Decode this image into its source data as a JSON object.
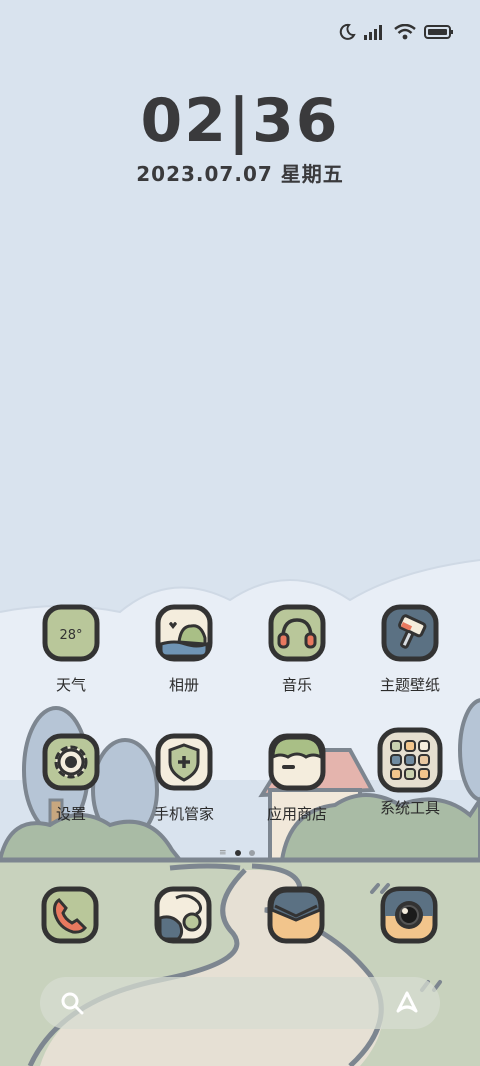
{
  "clock": {
    "time": "02|36",
    "date": "2023.07.07 星期五"
  },
  "weather_temp": "28°",
  "apps": [
    {
      "id": "weather",
      "label": "天气"
    },
    {
      "id": "gallery",
      "label": "相册"
    },
    {
      "id": "music",
      "label": "音乐"
    },
    {
      "id": "themes",
      "label": "主题壁纸"
    },
    {
      "id": "settings",
      "label": "设置"
    },
    {
      "id": "security",
      "label": "手机管家"
    },
    {
      "id": "appstore",
      "label": "应用商店"
    },
    {
      "id": "tools",
      "label": "系统工具"
    }
  ],
  "dock": [
    "phone-icon",
    "browser-icon",
    "messages-icon",
    "camera-icon"
  ],
  "status_icons": [
    "moon-icon",
    "signal-icon",
    "wifi-icon",
    "battery-icon"
  ],
  "colors": {
    "sky": "#d9e3ee",
    "ink": "#3a3a3c",
    "sage": "#b9c79a",
    "cream": "#f4eddd",
    "grass": "#c7d1bd"
  }
}
